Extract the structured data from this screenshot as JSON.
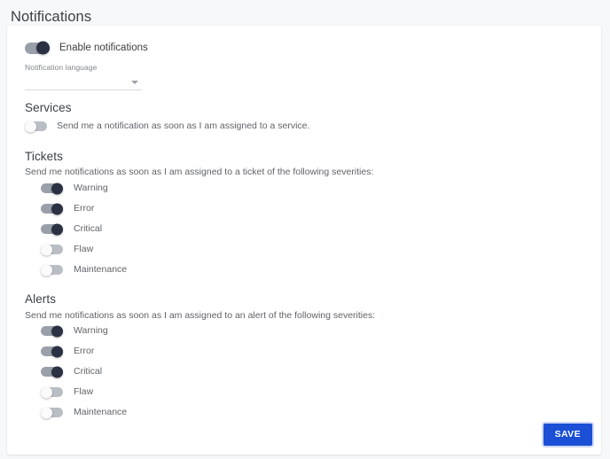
{
  "page": {
    "title": "Notifications"
  },
  "enable": {
    "label": "Enable notifications",
    "state": "on"
  },
  "language_field": {
    "label": "Notification language",
    "value": "",
    "placeholder": "",
    "chevron_icon": "chevron-down-icon"
  },
  "services": {
    "title": "Services",
    "row": {
      "label": "Send me a notification as soon as I am assigned to a service.",
      "state": "off"
    }
  },
  "tickets": {
    "title": "Tickets",
    "description": "Send me notifications as soon as I am assigned to a ticket of the following severities:",
    "severities": [
      {
        "label": "Warning",
        "state": "on"
      },
      {
        "label": "Error",
        "state": "on"
      },
      {
        "label": "Critical",
        "state": "on"
      },
      {
        "label": "Flaw",
        "state": "off"
      },
      {
        "label": "Maintenance",
        "state": "off"
      }
    ]
  },
  "alerts": {
    "title": "Alerts",
    "description": "Send me notifications as soon as I am assigned to an alert of the following severities:",
    "severities": [
      {
        "label": "Warning",
        "state": "on"
      },
      {
        "label": "Error",
        "state": "on"
      },
      {
        "label": "Critical",
        "state": "on"
      },
      {
        "label": "Flaw",
        "state": "off"
      },
      {
        "label": "Maintenance",
        "state": "off"
      }
    ]
  },
  "footer": {
    "save_label": "SAVE"
  },
  "colors": {
    "page_background": "#f7f8f9",
    "card_background": "#ffffff",
    "heading_text": "#3c4043",
    "body_text": "#5f6368",
    "toggle_on_knob": "#2a3142",
    "toggle_track": "#9aa0a9",
    "toggle_off_track": "#b9bdc4",
    "save_button": "#1a4fd6"
  }
}
